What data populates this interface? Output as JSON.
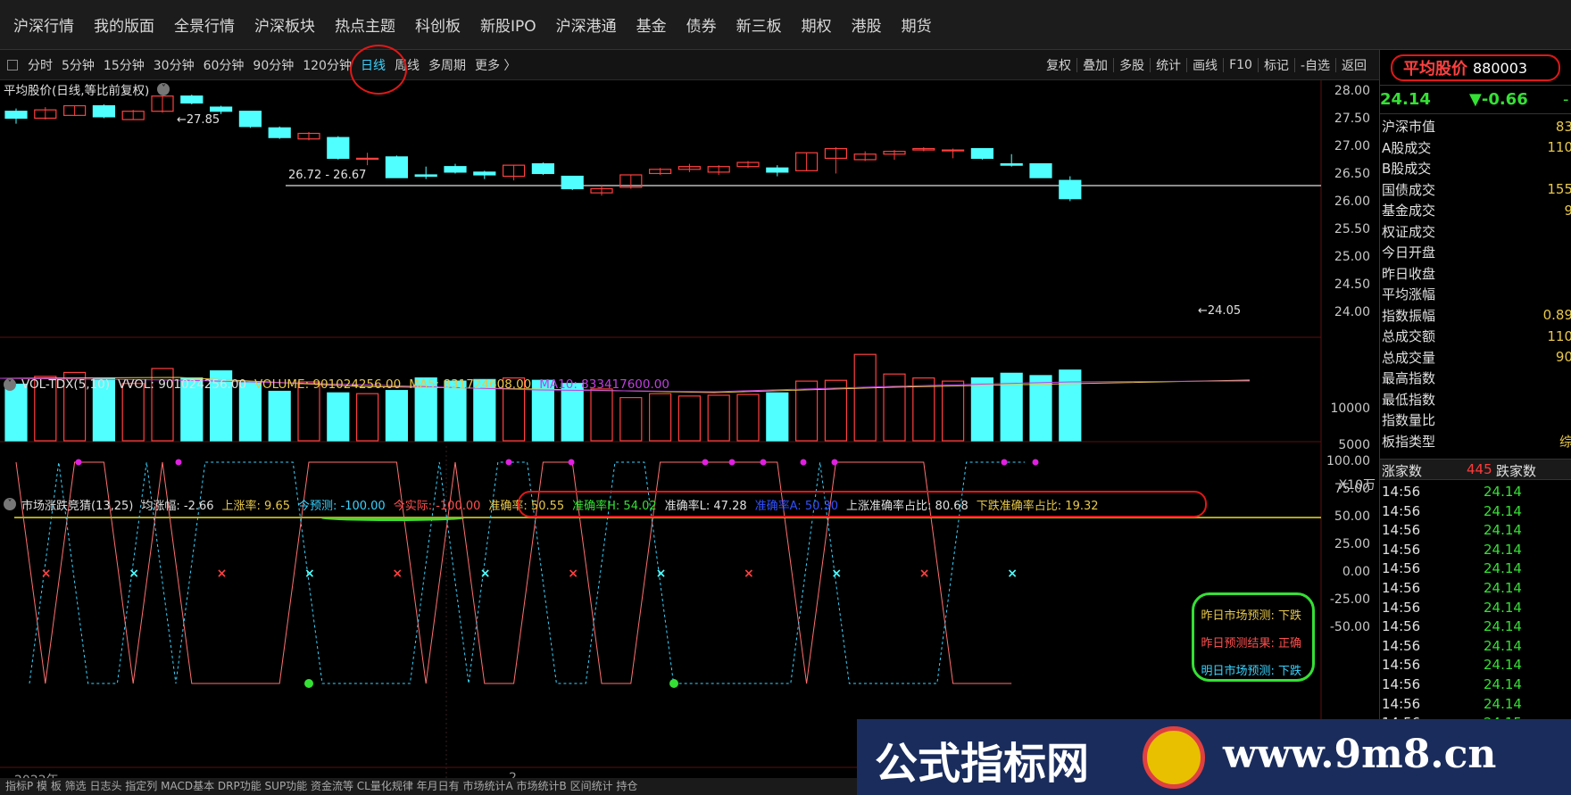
{
  "nav": [
    "沪深行情",
    "我的版面",
    "全景行情",
    "沪深板块",
    "热点主题",
    "科创板",
    "新股IPO",
    "沪深港通",
    "基金",
    "债券",
    "新三板",
    "期权",
    "港股",
    "期货"
  ],
  "periods": [
    "分时",
    "5分钟",
    "15分钟",
    "30分钟",
    "60分钟",
    "90分钟",
    "120分钟",
    "日线",
    "周线",
    "多周期",
    "更多 〉"
  ],
  "active_period": "日线",
  "tools": [
    "复权",
    "叠加",
    "多股",
    "统计",
    "画线",
    "F10",
    "标记",
    "-自选",
    "返回"
  ],
  "chart_title": "平均股价(日线,等比前复权)",
  "candle_labels": {
    "high": "27.85",
    "hline": "26.72 - 26.67",
    "low": "24.05"
  },
  "price_axis": [
    "28.00",
    "27.50",
    "27.00",
    "26.50",
    "26.00",
    "25.50",
    "25.00",
    "24.50",
    "24.00"
  ],
  "vol_legend": {
    "name": "VOL-TDX(5,10)",
    "vvol": "VVOL: 901024256.00",
    "volume": "VOLUME: 901024256.00",
    "ma5": "MA5: 831724608.00",
    "ma10": "MA10: 833417600.00"
  },
  "vol_axis": [
    "10000",
    "5000"
  ],
  "vol_unit": "X10万",
  "ind_legend": {
    "name": "市场涨跌竞猜(13,25)",
    "avg": "均涨幅: -2.66",
    "up": "上涨率: 9.65",
    "pred": "今预测: -100.00",
    "actual": "今实际: -100.00",
    "acc": "准确率: 50.55",
    "acch": "准确率H: 54.02",
    "accl": "准确率L: 47.28",
    "acca": "准确率A: 50.30",
    "upacc": "上涨准确率占比: 80.68",
    "dnacc": "下跌准确率占比: 19.32"
  },
  "ind_axis": [
    "100.00",
    "75.00",
    "50.00",
    "25.00",
    "0.00",
    "-25.00",
    "-50.00"
  ],
  "prediction": {
    "yesterday": "昨日市场预测: 下跌",
    "result": "昨日预测结果: 正确",
    "tomorrow": "明日市场预测: 下跌"
  },
  "year_label": "2022年",
  "month_label": "2",
  "right_panel": {
    "name": "平均股价",
    "code": "880003",
    "price": "24.14",
    "change": "▼-0.66",
    "change_pct": "-",
    "stats": [
      {
        "label": "沪深市值",
        "value": "83"
      },
      {
        "label": "A股成交",
        "value": "110"
      },
      {
        "label": "B股成交",
        "value": ""
      },
      {
        "label": "国债成交",
        "value": "155"
      },
      {
        "label": "基金成交",
        "value": "9"
      },
      {
        "label": "权证成交",
        "value": ""
      },
      {
        "label": "今日开盘",
        "value": ""
      },
      {
        "label": "昨日收盘",
        "value": ""
      },
      {
        "label": "平均涨幅",
        "value": ""
      },
      {
        "label": "指数振幅",
        "value": "0.89"
      },
      {
        "label": "总成交额",
        "value": "110"
      },
      {
        "label": "总成交量",
        "value": "90"
      },
      {
        "label": "最高指数",
        "value": ""
      },
      {
        "label": "最低指数",
        "value": ""
      },
      {
        "label": "指数量比",
        "value": ""
      },
      {
        "label": "板指类型",
        "value": "综"
      }
    ],
    "rise_label": "涨家数",
    "rise_count": "445",
    "fall_label": "跌家数",
    "ticks": [
      {
        "t": "14:56",
        "p": "24.14"
      },
      {
        "t": "14:56",
        "p": "24.14"
      },
      {
        "t": "14:56",
        "p": "24.14"
      },
      {
        "t": "14:56",
        "p": "24.14"
      },
      {
        "t": "14:56",
        "p": "24.14"
      },
      {
        "t": "14:56",
        "p": "24.14"
      },
      {
        "t": "14:56",
        "p": "24.14"
      },
      {
        "t": "14:56",
        "p": "24.14"
      },
      {
        "t": "14:56",
        "p": "24.14"
      },
      {
        "t": "14:56",
        "p": "24.14"
      },
      {
        "t": "14:56",
        "p": "24.14"
      },
      {
        "t": "14:56",
        "p": "24.14"
      },
      {
        "t": "14:56",
        "p": "24.15"
      }
    ]
  },
  "banner": {
    "title": "公式指标网",
    "url": "www.9m8.cn"
  },
  "bottom_text": "指标P 模 板 筛选 日志头 指定列 MACD基本 DRP功能 SUP功能 资金流等 CL量化规律 年月日有 市场统计A 市场统计B 区间统计 持仓"
}
